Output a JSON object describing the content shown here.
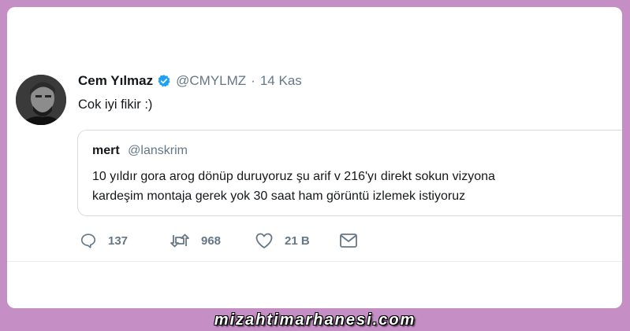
{
  "tweet": {
    "author_name": "Cem Yılmaz",
    "author_handle": "@CMYLMZ",
    "separator": "·",
    "date": "14 Kas",
    "text": "Cok iyi fikir :)",
    "avatar_icon": "avatar-photo",
    "verified_icon": "verified-badge-icon",
    "colors": {
      "verified": "#1da1f2",
      "text": "#14171a",
      "muted": "#657786"
    }
  },
  "quote": {
    "name": "mert",
    "handle": "@lanskrim",
    "line1": "10 yıldır gora arog dönüp duruyoruz şu arif v 216'yı direkt sokun vizyona",
    "line2": "kardeşim montaja gerek yok 30 saat ham görüntü izlemek istiyoruz"
  },
  "actions": {
    "reply_count": "137",
    "retweet_count": "968",
    "like_count": "21 B",
    "icons": [
      "reply-icon",
      "retweet-icon",
      "like-icon",
      "message-icon"
    ]
  },
  "watermark": "mizahtimarhanesi.com"
}
